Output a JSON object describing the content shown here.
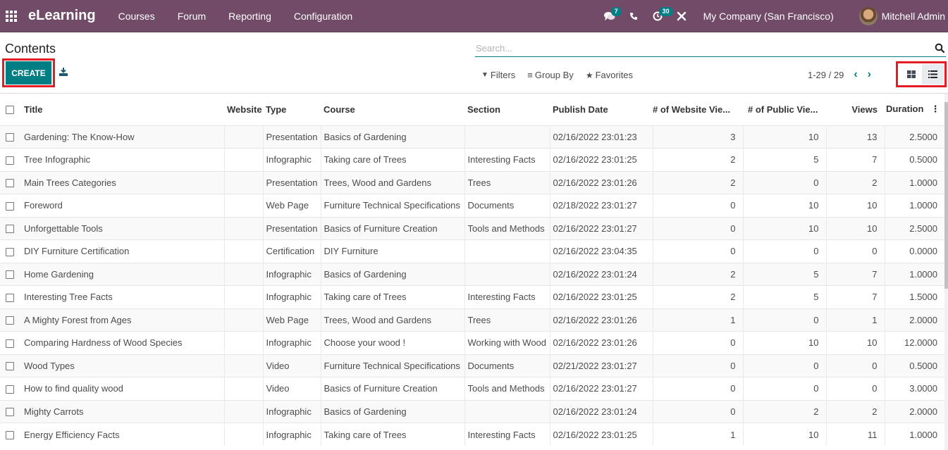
{
  "navbar": {
    "brand": "eLearning",
    "menu": [
      "Courses",
      "Forum",
      "Reporting",
      "Configuration"
    ],
    "messages_badge": "7",
    "activities_badge": "30",
    "company": "My Company (San Francisco)",
    "user": "Mitchell Admin"
  },
  "control": {
    "title": "Contents",
    "create_label": "CREATE",
    "search_placeholder": "Search...",
    "filters_label": "Filters",
    "group_by_label": "Group By",
    "favorites_label": "Favorites",
    "pager": "1-29 / 29"
  },
  "table": {
    "columns": [
      "Title",
      "Website",
      "Type",
      "Course",
      "Section",
      "Publish Date",
      "# of Website Vie...",
      "# of Public Vie...",
      "Views",
      "Duration"
    ],
    "rows": [
      {
        "title": "Gardening: The Know-How",
        "website": "",
        "type": "Presentation",
        "course": "Basics of Gardening",
        "section": "",
        "date": "02/16/2022 23:01:23",
        "web_views": "3",
        "public_views": "10",
        "views": "13",
        "duration": "2.5000"
      },
      {
        "title": "Tree Infographic",
        "website": "",
        "type": "Infographic",
        "course": "Taking care of Trees",
        "section": "Interesting Facts",
        "date": "02/16/2022 23:01:25",
        "web_views": "2",
        "public_views": "5",
        "views": "7",
        "duration": "0.5000"
      },
      {
        "title": "Main Trees Categories",
        "website": "",
        "type": "Presentation",
        "course": "Trees, Wood and Gardens",
        "section": "Trees",
        "date": "02/16/2022 23:01:26",
        "web_views": "2",
        "public_views": "0",
        "views": "2",
        "duration": "1.0000"
      },
      {
        "title": "Foreword",
        "website": "",
        "type": "Web Page",
        "course": "Furniture Technical Specifications",
        "section": "Documents",
        "date": "02/18/2022 23:01:27",
        "web_views": "0",
        "public_views": "10",
        "views": "10",
        "duration": "1.0000"
      },
      {
        "title": "Unforgettable Tools",
        "website": "",
        "type": "Presentation",
        "course": "Basics of Furniture Creation",
        "section": "Tools and Methods",
        "date": "02/16/2022 23:01:27",
        "web_views": "0",
        "public_views": "10",
        "views": "10",
        "duration": "2.5000"
      },
      {
        "title": "DIY Furniture Certification",
        "website": "",
        "type": "Certification",
        "course": "DIY Furniture",
        "section": "",
        "date": "02/16/2022 23:04:35",
        "web_views": "0",
        "public_views": "0",
        "views": "0",
        "duration": "0.0000"
      },
      {
        "title": "Home Gardening",
        "website": "",
        "type": "Infographic",
        "course": "Basics of Gardening",
        "section": "",
        "date": "02/16/2022 23:01:24",
        "web_views": "2",
        "public_views": "5",
        "views": "7",
        "duration": "1.0000"
      },
      {
        "title": "Interesting Tree Facts",
        "website": "",
        "type": "Infographic",
        "course": "Taking care of Trees",
        "section": "Interesting Facts",
        "date": "02/16/2022 23:01:25",
        "web_views": "2",
        "public_views": "5",
        "views": "7",
        "duration": "1.5000"
      },
      {
        "title": "A Mighty Forest from Ages",
        "website": "",
        "type": "Web Page",
        "course": "Trees, Wood and Gardens",
        "section": "Trees",
        "date": "02/16/2022 23:01:26",
        "web_views": "1",
        "public_views": "0",
        "views": "1",
        "duration": "2.0000"
      },
      {
        "title": "Comparing Hardness of Wood Species",
        "website": "",
        "type": "Infographic",
        "course": "Choose your wood !",
        "section": "Working with Wood",
        "date": "02/16/2022 23:01:26",
        "web_views": "0",
        "public_views": "10",
        "views": "10",
        "duration": "12.0000"
      },
      {
        "title": "Wood Types",
        "website": "",
        "type": "Video",
        "course": "Furniture Technical Specifications",
        "section": "Documents",
        "date": "02/21/2022 23:01:27",
        "web_views": "0",
        "public_views": "0",
        "views": "0",
        "duration": "0.5000"
      },
      {
        "title": "How to find quality wood",
        "website": "",
        "type": "Video",
        "course": "Basics of Furniture Creation",
        "section": "Tools and Methods",
        "date": "02/16/2022 23:01:27",
        "web_views": "0",
        "public_views": "0",
        "views": "0",
        "duration": "3.0000"
      },
      {
        "title": "Mighty Carrots",
        "website": "",
        "type": "Infographic",
        "course": "Basics of Gardening",
        "section": "",
        "date": "02/16/2022 23:01:24",
        "web_views": "0",
        "public_views": "2",
        "views": "2",
        "duration": "2.0000"
      },
      {
        "title": "Energy Efficiency Facts",
        "website": "",
        "type": "Infographic",
        "course": "Taking care of Trees",
        "section": "Interesting Facts",
        "date": "02/16/2022 23:01:25",
        "web_views": "1",
        "public_views": "10",
        "views": "11",
        "duration": "1.0000"
      }
    ]
  }
}
